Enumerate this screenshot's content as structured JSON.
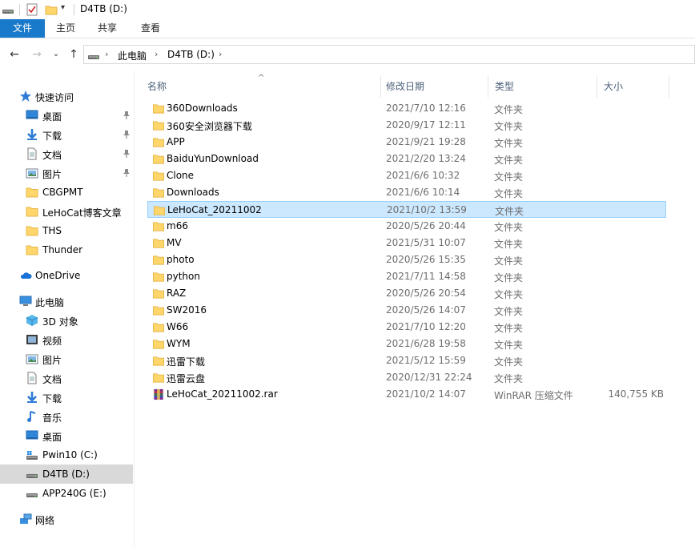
{
  "window": {
    "title": "D4TB (D:)"
  },
  "ribbon": {
    "tabs": [
      "文件",
      "主页",
      "共享",
      "查看"
    ]
  },
  "address": {
    "segments": [
      "此电脑",
      "D4TB (D:)"
    ]
  },
  "sidebar": {
    "quick_access": "快速访问",
    "quick_items": [
      {
        "label": "桌面",
        "icon": "desktop-icon",
        "pinned": true
      },
      {
        "label": "下载",
        "icon": "download-icon",
        "pinned": true
      },
      {
        "label": "文档",
        "icon": "document-icon",
        "pinned": true
      },
      {
        "label": "图片",
        "icon": "pictures-icon",
        "pinned": true
      },
      {
        "label": "CBGPMT",
        "icon": "folder-icon",
        "pinned": false
      },
      {
        "label": "LeHoCat博客文章",
        "icon": "folder-icon",
        "pinned": false
      },
      {
        "label": "THS",
        "icon": "folder-icon",
        "pinned": false
      },
      {
        "label": "Thunder",
        "icon": "folder-icon",
        "pinned": false
      }
    ],
    "onedrive": "OneDrive",
    "this_pc": "此电脑",
    "pc_items": [
      {
        "label": "3D 对象",
        "icon": "3d-objects-icon"
      },
      {
        "label": "视频",
        "icon": "video-icon"
      },
      {
        "label": "图片",
        "icon": "pictures-icon"
      },
      {
        "label": "文档",
        "icon": "document-icon"
      },
      {
        "label": "下载",
        "icon": "download-icon"
      },
      {
        "label": "音乐",
        "icon": "music-icon"
      },
      {
        "label": "桌面",
        "icon": "desktop-icon"
      },
      {
        "label": "Pwin10 (C:)",
        "icon": "windows-drive-icon"
      },
      {
        "label": "D4TB (D:)",
        "icon": "drive-icon",
        "selected": true
      },
      {
        "label": "APP240G (E:)",
        "icon": "drive-icon"
      }
    ],
    "network": "网络"
  },
  "columns": {
    "name": "名称",
    "date": "修改日期",
    "type": "类型",
    "size": "大小"
  },
  "files": [
    {
      "name": "360Downloads",
      "date": "2021/7/10 12:16",
      "type": "文件夹",
      "size": "",
      "kind": "folder"
    },
    {
      "name": "360安全浏览器下载",
      "date": "2020/9/17 12:11",
      "type": "文件夹",
      "size": "",
      "kind": "folder"
    },
    {
      "name": "APP",
      "date": "2021/9/21 19:28",
      "type": "文件夹",
      "size": "",
      "kind": "folder"
    },
    {
      "name": "BaiduYunDownload",
      "date": "2021/2/20 13:24",
      "type": "文件夹",
      "size": "",
      "kind": "folder"
    },
    {
      "name": "Clone",
      "date": "2021/6/6 10:32",
      "type": "文件夹",
      "size": "",
      "kind": "folder"
    },
    {
      "name": "Downloads",
      "date": "2021/6/6 10:14",
      "type": "文件夹",
      "size": "",
      "kind": "folder"
    },
    {
      "name": "LeHoCat_20211002",
      "date": "2021/10/2 13:59",
      "type": "文件夹",
      "size": "",
      "kind": "folder",
      "selected": true
    },
    {
      "name": "m66",
      "date": "2020/5/26 20:44",
      "type": "文件夹",
      "size": "",
      "kind": "folder"
    },
    {
      "name": "MV",
      "date": "2021/5/31 10:07",
      "type": "文件夹",
      "size": "",
      "kind": "folder"
    },
    {
      "name": "photo",
      "date": "2020/5/26 15:35",
      "type": "文件夹",
      "size": "",
      "kind": "folder"
    },
    {
      "name": "python",
      "date": "2021/7/11 14:58",
      "type": "文件夹",
      "size": "",
      "kind": "folder"
    },
    {
      "name": "RAZ",
      "date": "2020/5/26 20:54",
      "type": "文件夹",
      "size": "",
      "kind": "folder"
    },
    {
      "name": "SW2016",
      "date": "2020/5/26 14:07",
      "type": "文件夹",
      "size": "",
      "kind": "folder"
    },
    {
      "name": "W66",
      "date": "2021/7/10 12:20",
      "type": "文件夹",
      "size": "",
      "kind": "folder"
    },
    {
      "name": "WYM",
      "date": "2021/6/28 19:58",
      "type": "文件夹",
      "size": "",
      "kind": "folder"
    },
    {
      "name": "迅雷下载",
      "date": "2021/5/12 15:59",
      "type": "文件夹",
      "size": "",
      "kind": "folder"
    },
    {
      "name": "迅雷云盘",
      "date": "2020/12/31 22:24",
      "type": "文件夹",
      "size": "",
      "kind": "folder"
    },
    {
      "name": "LeHoCat_20211002.rar",
      "date": "2021/10/2 14:07",
      "type": "WinRAR 压缩文件",
      "size": "140,755 KB",
      "kind": "rar"
    }
  ],
  "colors": {
    "accent": "#1979ca",
    "selection": "#cce8ff",
    "selection_border": "#99d1ff",
    "folder": "#ffd66b",
    "header_text": "#4c607a"
  }
}
